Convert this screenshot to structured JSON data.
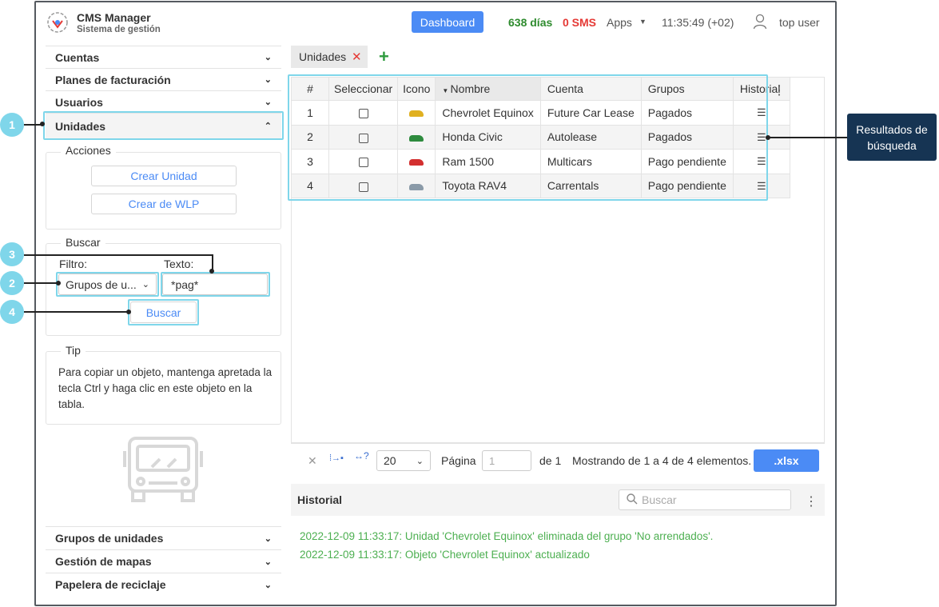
{
  "header": {
    "title": "CMS Manager",
    "subtitle": "Sistema de gestión",
    "dashboard": "Dashboard",
    "days": "638 días",
    "sms": "0 SMS",
    "apps": "Apps",
    "clock": "11:35:49 (+02)",
    "user": "top user"
  },
  "sidebar": {
    "top_items": [
      "Cuentas",
      "Planes de facturación",
      "Usuarios",
      "Unidades"
    ],
    "acciones_legend": "Acciones",
    "crear_unidad": "Crear Unidad",
    "crear_wlp": "Crear de WLP",
    "buscar_legend": "Buscar",
    "filtro_label": "Filtro:",
    "texto_label": "Texto:",
    "filtro_value": "Grupos de u...",
    "texto_value": "*pag*",
    "buscar_btn": "Buscar",
    "tip_legend": "Tip",
    "tip_text": "Para copiar un objeto, mantenga apretada la tecla Ctrl y haga clic en este objeto en la tabla.",
    "bottom_items": [
      "Grupos de unidades",
      "Gestión de mapas",
      "Papelera de reciclaje"
    ]
  },
  "callouts": [
    "1",
    "2",
    "3",
    "4"
  ],
  "result_label": "Resultados de búsqueda",
  "tab": {
    "label": "Unidades"
  },
  "table": {
    "headers": [
      "#",
      "Seleccionar",
      "Icono",
      "Nombre",
      "Cuenta",
      "Grupos",
      "Historial"
    ],
    "rows": [
      {
        "n": "1",
        "nombre": "Chevrolet Equinox",
        "cuenta": "Future Car Lease",
        "grupos": "Pagados",
        "car": "#e0b020"
      },
      {
        "n": "2",
        "nombre": "Honda Civic",
        "cuenta": "Autolease",
        "grupos": "Pagados",
        "car": "#2e8b3e"
      },
      {
        "n": "3",
        "nombre": "Ram 1500",
        "cuenta": "Multicars",
        "grupos": "Pago pendiente",
        "car": "#d32f2f"
      },
      {
        "n": "4",
        "nombre": "Toyota RAV4",
        "cuenta": "Carrentals",
        "grupos": "Pago pendiente",
        "car": "#8a9aa8"
      }
    ]
  },
  "pager": {
    "per_page": "20",
    "pagina": "Página",
    "page_value": "1",
    "de": "de 1",
    "mostrando": "Mostrando de 1 a 4 de 4 elementos.",
    "xlsx": ".xlsx"
  },
  "historial": {
    "title": "Historial",
    "search_placeholder": "Buscar",
    "entries": [
      "2022-12-09 11:33:17: Unidad 'Chevrolet Equinox' eliminada del grupo 'No arrendados'.",
      "2022-12-09 11:33:17: Objeto 'Chevrolet Equinox' actualizado"
    ]
  }
}
